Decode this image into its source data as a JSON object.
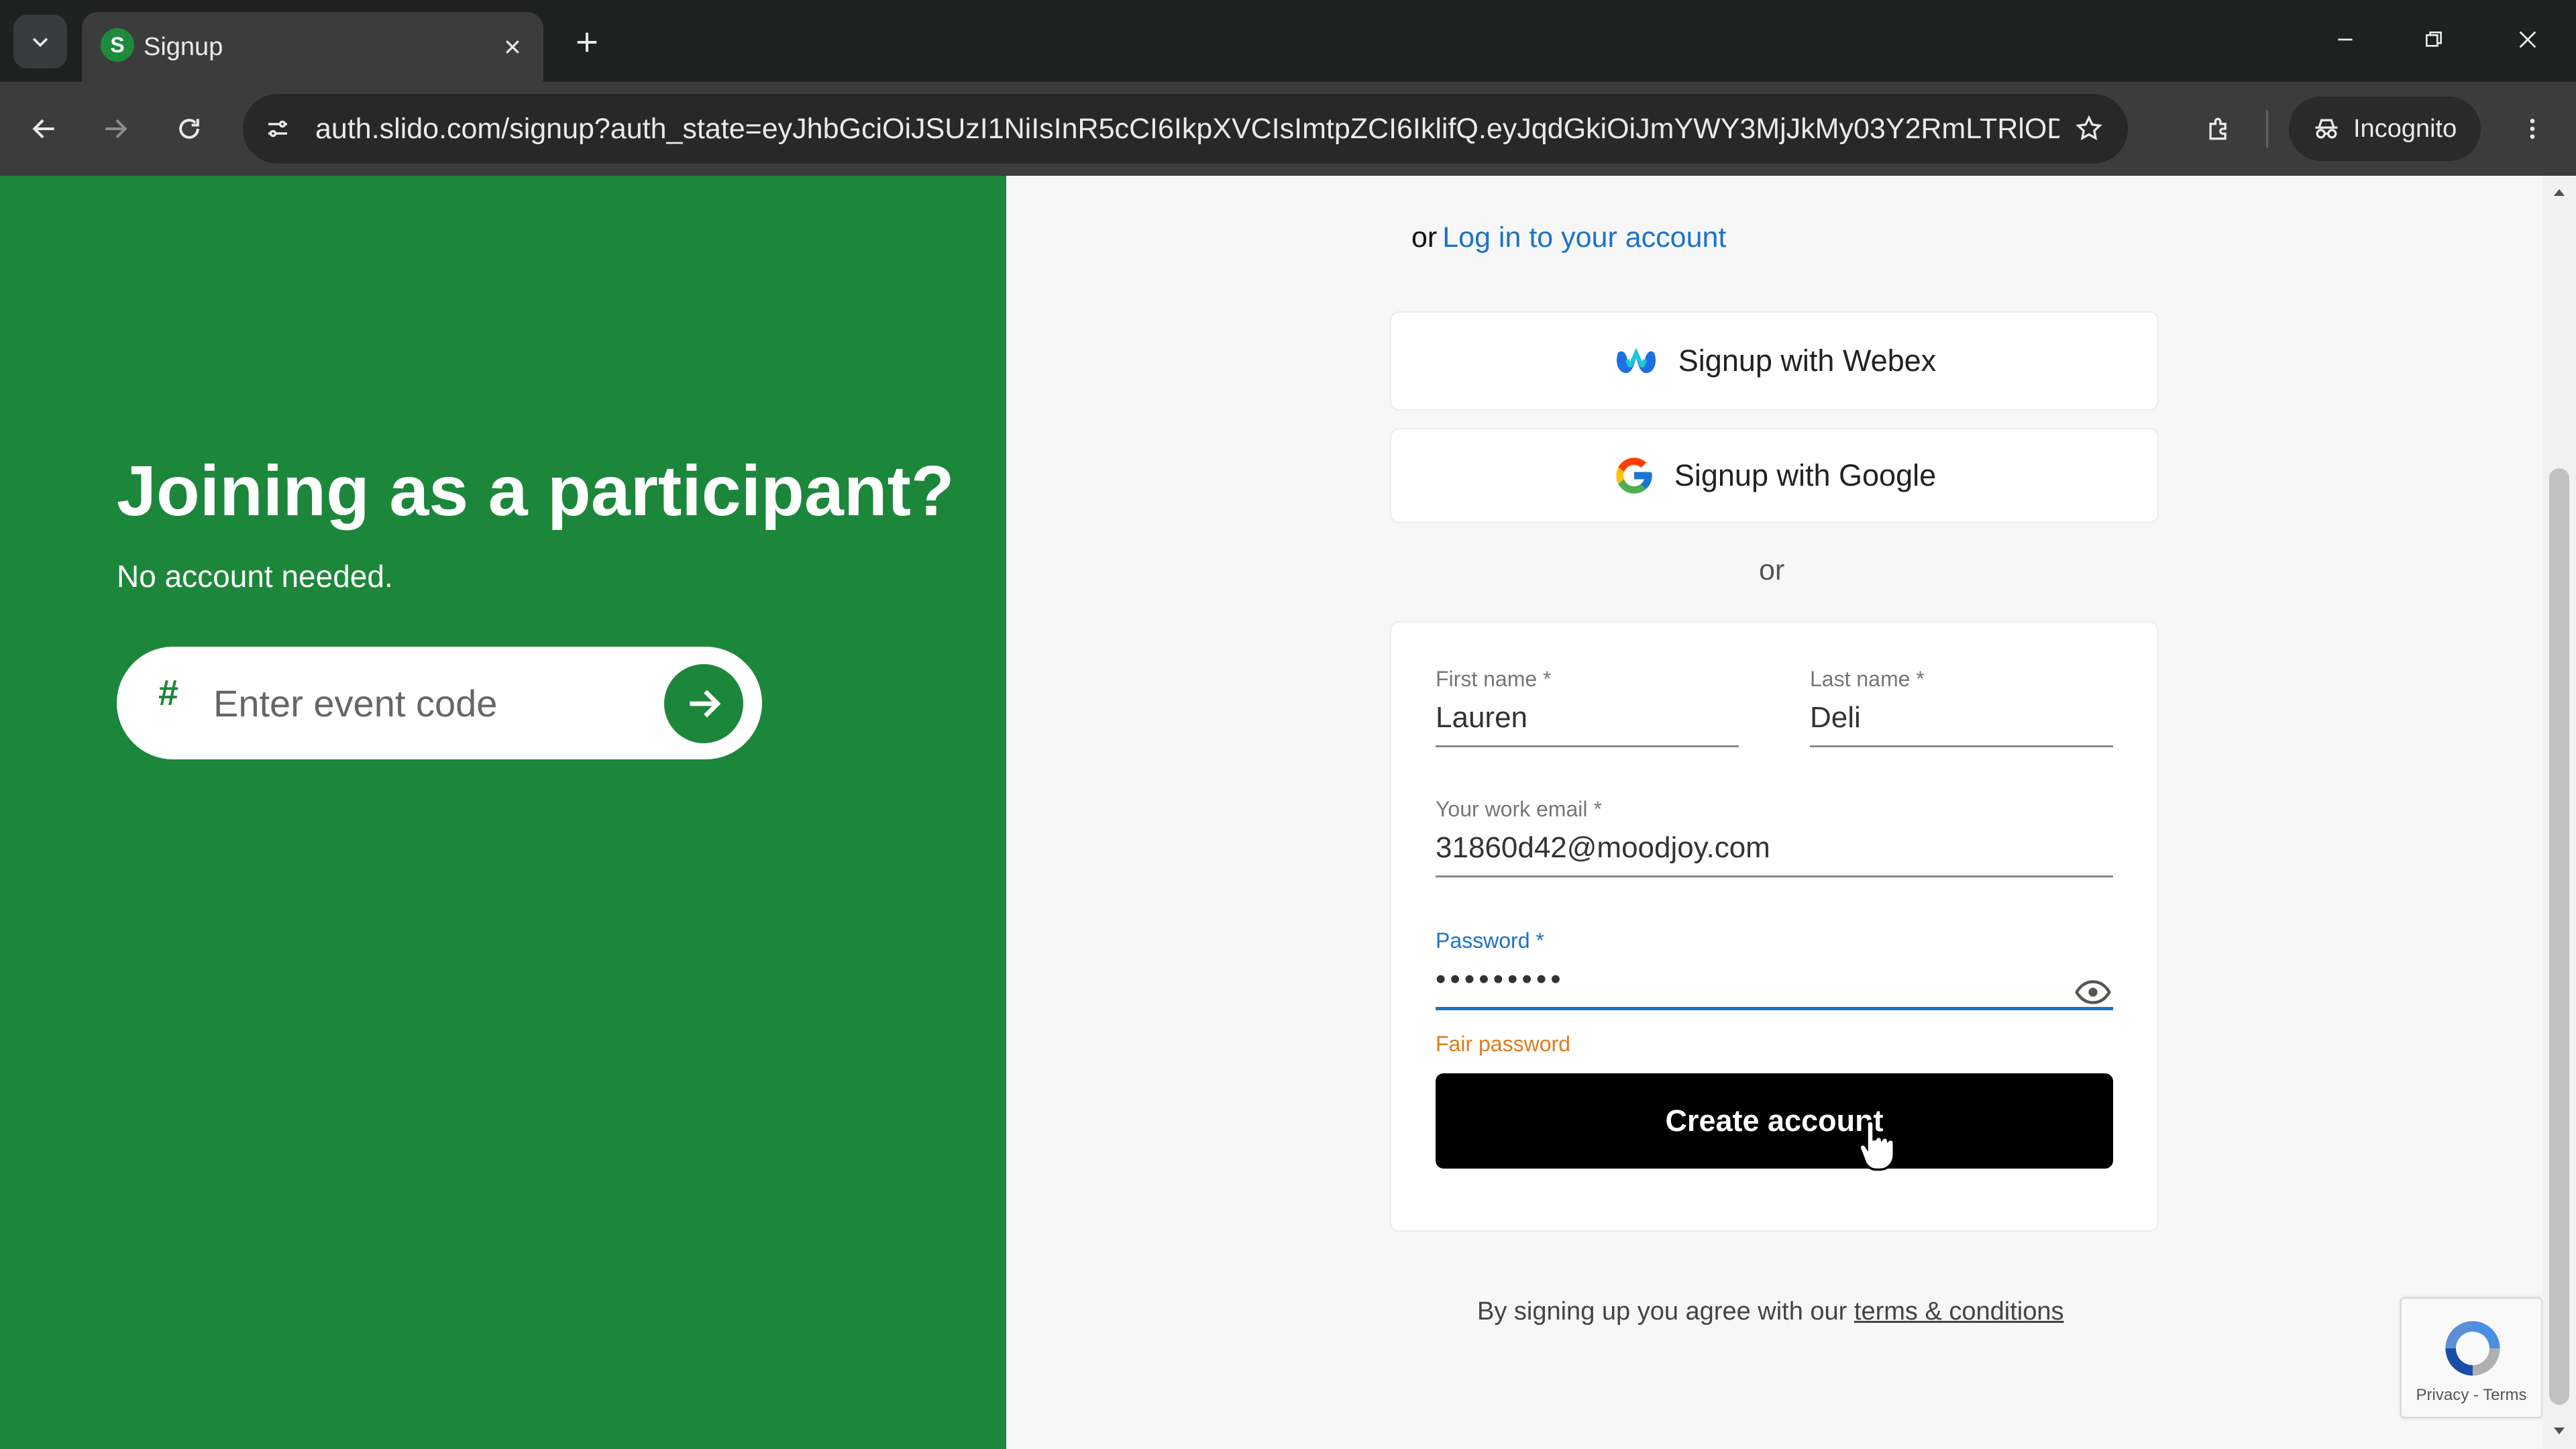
{
  "browser": {
    "tab_title": "Signup",
    "tab_favicon_letter": "S",
    "url": "auth.slido.com/signup?auth_state=eyJhbGciOiJSUzI1NiIsInR5cCI6IkpXVCIsImtpZCI6IklifQ.eyJqdGkiOiJmYWY3MjJkMy03Y2RmLTRlODktOGQ...",
    "incognito_label": "Incognito"
  },
  "left": {
    "title": "Joining as a participant?",
    "subtitle": "No account needed.",
    "event_code_placeholder": "Enter event code",
    "hash_symbol": "#"
  },
  "signup": {
    "or_prefix": "or",
    "login_link": "Log in to your account",
    "webex_label": "Signup with Webex",
    "google_label": "Signup with Google",
    "or_divider": "or",
    "first_name_label": "First name *",
    "first_name_value": "Lauren",
    "last_name_label": "Last name *",
    "last_name_value": "Deli",
    "email_label": "Your work email *",
    "email_value": "31860d42@moodjoy.com",
    "password_label": "Password *",
    "password_value": "•••••••••",
    "password_strength": "Fair password",
    "create_button": "Create account"
  },
  "footer": {
    "terms_prefix": "By signing up you agree with our",
    "terms_link": "terms & conditions"
  },
  "recaptcha": {
    "links": "Privacy - Terms"
  },
  "colors": {
    "brand_green": "#1c873a",
    "link_blue": "#1a73c9",
    "strength_orange": "#e07b1e"
  }
}
